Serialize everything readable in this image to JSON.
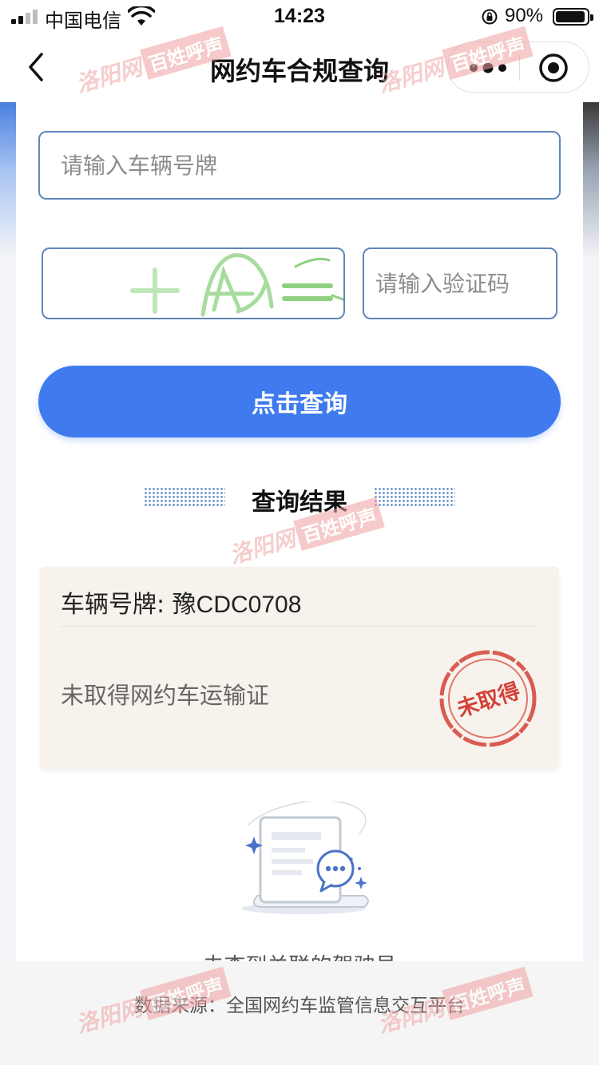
{
  "status_bar": {
    "carrier": "中国电信",
    "time": "14:23",
    "battery": "90%",
    "battery_level": 0.9
  },
  "nav": {
    "title": "网约车合规查询",
    "icons": [
      "back-chevron-icon",
      "more-dots-icon",
      "target-icon"
    ]
  },
  "form": {
    "plate_placeholder": "请输入车辆号牌",
    "plate_value": "",
    "captcha_text": "+ A =",
    "code_placeholder": "请输入验证码",
    "code_value": "",
    "query_label": "点击查询"
  },
  "result": {
    "section_title": "查询结果",
    "plate_label": "车辆号牌: ",
    "plate_value": "豫CDC0708",
    "status_text": "未取得网约车运输证",
    "stamp_text": "未取得"
  },
  "empty_state_text": "未查到关联的驾驶员",
  "footer": {
    "source": "数据来源：全国网约车监管信息交互平台"
  },
  "watermark": {
    "site": "洛阳网",
    "channel": "百姓呼声"
  },
  "colors": {
    "accent": "#3f7bee",
    "input_border": "#5f86b8",
    "result_bg": "#f8f2ec",
    "stamp_red": "#d4423a"
  }
}
